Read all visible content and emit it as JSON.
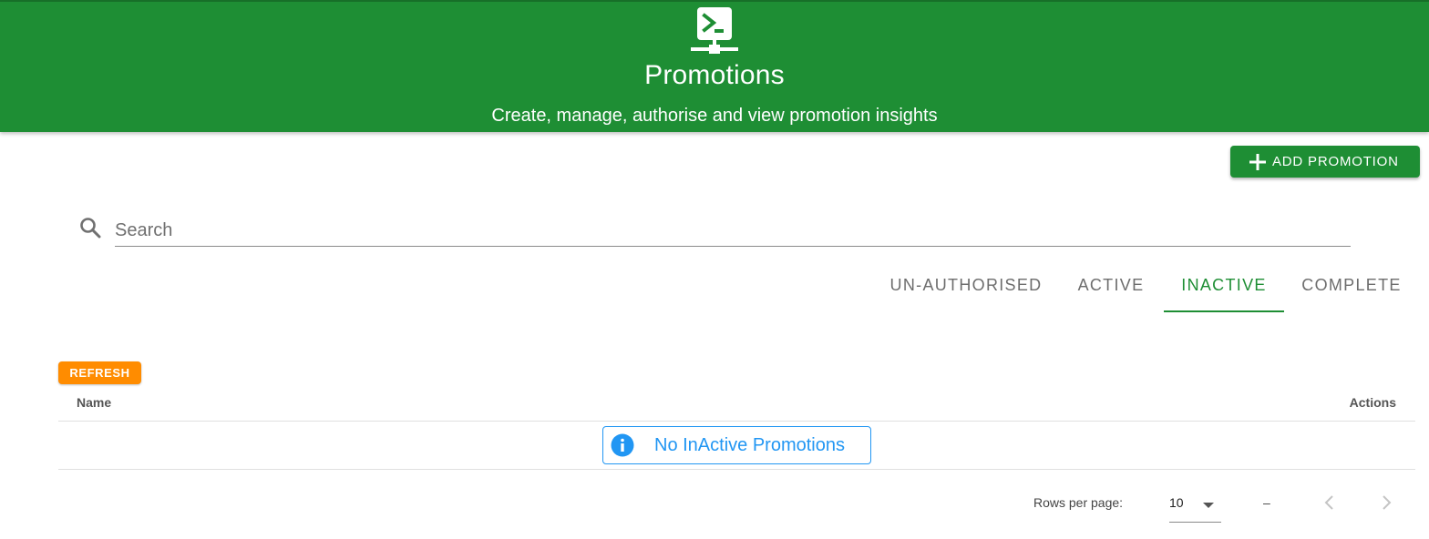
{
  "header": {
    "icon": "terminal-network-icon",
    "title": "Promotions",
    "subtitle": "Create, manage, authorise and view promotion insights",
    "background_color": "#1e8e34"
  },
  "toolbar": {
    "add_label": "ADD PROMOTION",
    "add_icon": "plus-icon"
  },
  "search": {
    "placeholder": "Search",
    "value": "",
    "icon": "search-icon"
  },
  "tabs": [
    {
      "label": "UN-AUTHORISED",
      "selected": false
    },
    {
      "label": "ACTIVE",
      "selected": false
    },
    {
      "label": "INACTIVE",
      "selected": true
    },
    {
      "label": "COMPLETE",
      "selected": false
    }
  ],
  "refresh_label": "REFRESH",
  "table": {
    "columns": [
      "Name",
      "Actions"
    ],
    "rows": [],
    "empty_message": "No InActive Promotions",
    "empty_icon": "info-icon"
  },
  "pagination": {
    "rows_per_page_label": "Rows per page:",
    "rows_per_page_value": "10",
    "range": "–",
    "prev_icon": "chevron-left-icon",
    "next_icon": "chevron-right-icon"
  },
  "colors": {
    "primary": "#1e8e34",
    "refresh": "#ff8c00",
    "info": "#2196f3"
  }
}
